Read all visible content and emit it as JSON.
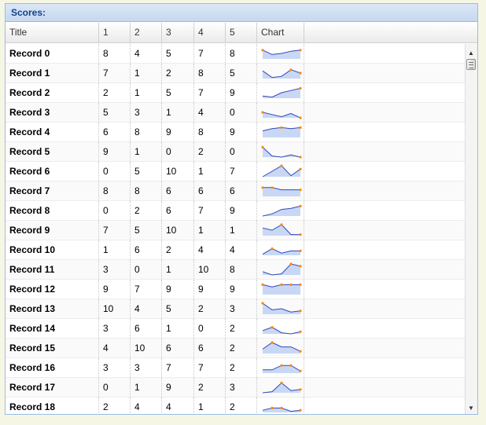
{
  "panel": {
    "title": "Scores:"
  },
  "columns": [
    "Title",
    "1",
    "2",
    "3",
    "4",
    "5",
    "Chart"
  ],
  "rows": [
    {
      "title": "Record 0",
      "values": [
        8,
        4,
        5,
        7,
        8
      ]
    },
    {
      "title": "Record 1",
      "values": [
        7,
        1,
        2,
        8,
        5
      ]
    },
    {
      "title": "Record 2",
      "values": [
        2,
        1,
        5,
        7,
        9
      ]
    },
    {
      "title": "Record 3",
      "values": [
        5,
        3,
        1,
        4,
        0
      ]
    },
    {
      "title": "Record 4",
      "values": [
        6,
        8,
        9,
        8,
        9
      ]
    },
    {
      "title": "Record 5",
      "values": [
        9,
        1,
        0,
        2,
        0
      ]
    },
    {
      "title": "Record 6",
      "values": [
        0,
        5,
        10,
        1,
        7
      ]
    },
    {
      "title": "Record 7",
      "values": [
        8,
        8,
        6,
        6,
        6
      ]
    },
    {
      "title": "Record 8",
      "values": [
        0,
        2,
        6,
        7,
        9
      ]
    },
    {
      "title": "Record 9",
      "values": [
        7,
        5,
        10,
        1,
        1
      ]
    },
    {
      "title": "Record 10",
      "values": [
        1,
        6,
        2,
        4,
        4
      ]
    },
    {
      "title": "Record 11",
      "values": [
        3,
        0,
        1,
        10,
        8
      ]
    },
    {
      "title": "Record 12",
      "values": [
        9,
        7,
        9,
        9,
        9
      ]
    },
    {
      "title": "Record 13",
      "values": [
        10,
        4,
        5,
        2,
        3
      ]
    },
    {
      "title": "Record 14",
      "values": [
        3,
        6,
        1,
        0,
        2
      ]
    },
    {
      "title": "Record 15",
      "values": [
        4,
        10,
        6,
        6,
        2
      ]
    },
    {
      "title": "Record 16",
      "values": [
        3,
        3,
        7,
        7,
        2
      ]
    },
    {
      "title": "Record 17",
      "values": [
        0,
        1,
        9,
        2,
        3
      ]
    },
    {
      "title": "Record 18",
      "values": [
        2,
        4,
        4,
        1,
        2
      ]
    }
  ],
  "colors": {
    "sparkline_line": "#3344bb",
    "sparkline_fill": "#c8d8f4",
    "sparkline_dot": "#ff8800"
  },
  "icons": {
    "scroll_up": "scroll-up-arrow-icon",
    "scroll_down": "scroll-down-arrow-icon",
    "thumb": "scroll-thumb-grip-icon"
  }
}
